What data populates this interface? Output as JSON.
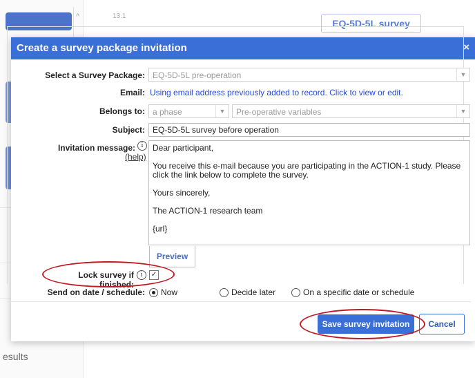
{
  "background": {
    "version": "13.1",
    "survey_button": "EQ-5D-5L survey",
    "sidebar_bottom": "esults"
  },
  "modal": {
    "title": "Create a survey package invitation",
    "close_icon": "×"
  },
  "form": {
    "survey_package_label": "Select a Survey Package:",
    "survey_package_value": "EQ-5D-5L pre-operation",
    "email_label": "Email:",
    "email_link": "Using email address previously added to record. Click to view or edit.",
    "belongs_label": "Belongs to:",
    "belongs_phase": "a phase",
    "belongs_value": "Pre-operative variables",
    "subject_label": "Subject:",
    "subject_value": "EQ-5D-5L survey before operation",
    "invitation_label": "Invitation message:",
    "help_link": "(help)",
    "message_lines": [
      "Dear participant,",
      "You receive this e-mail because you are participating in the ACTION-1 study. Please click the link below to complete the survey.",
      "Yours sincerely,",
      "The ACTION-1 research team",
      "{url}"
    ],
    "preview_button": "Preview",
    "lock_label": "Lock survey if finished:",
    "lock_checked": true,
    "send_label": "Send on date / schedule:",
    "send_options": [
      "Now",
      "Decide later",
      "On a specific date or schedule"
    ],
    "send_selected": "Now"
  },
  "footer": {
    "save_button": "Save survey invitation",
    "cancel_button": "Cancel"
  },
  "colors": {
    "accent": "#3a6fd8",
    "link": "#2549d6",
    "annotation": "#c0191f"
  }
}
